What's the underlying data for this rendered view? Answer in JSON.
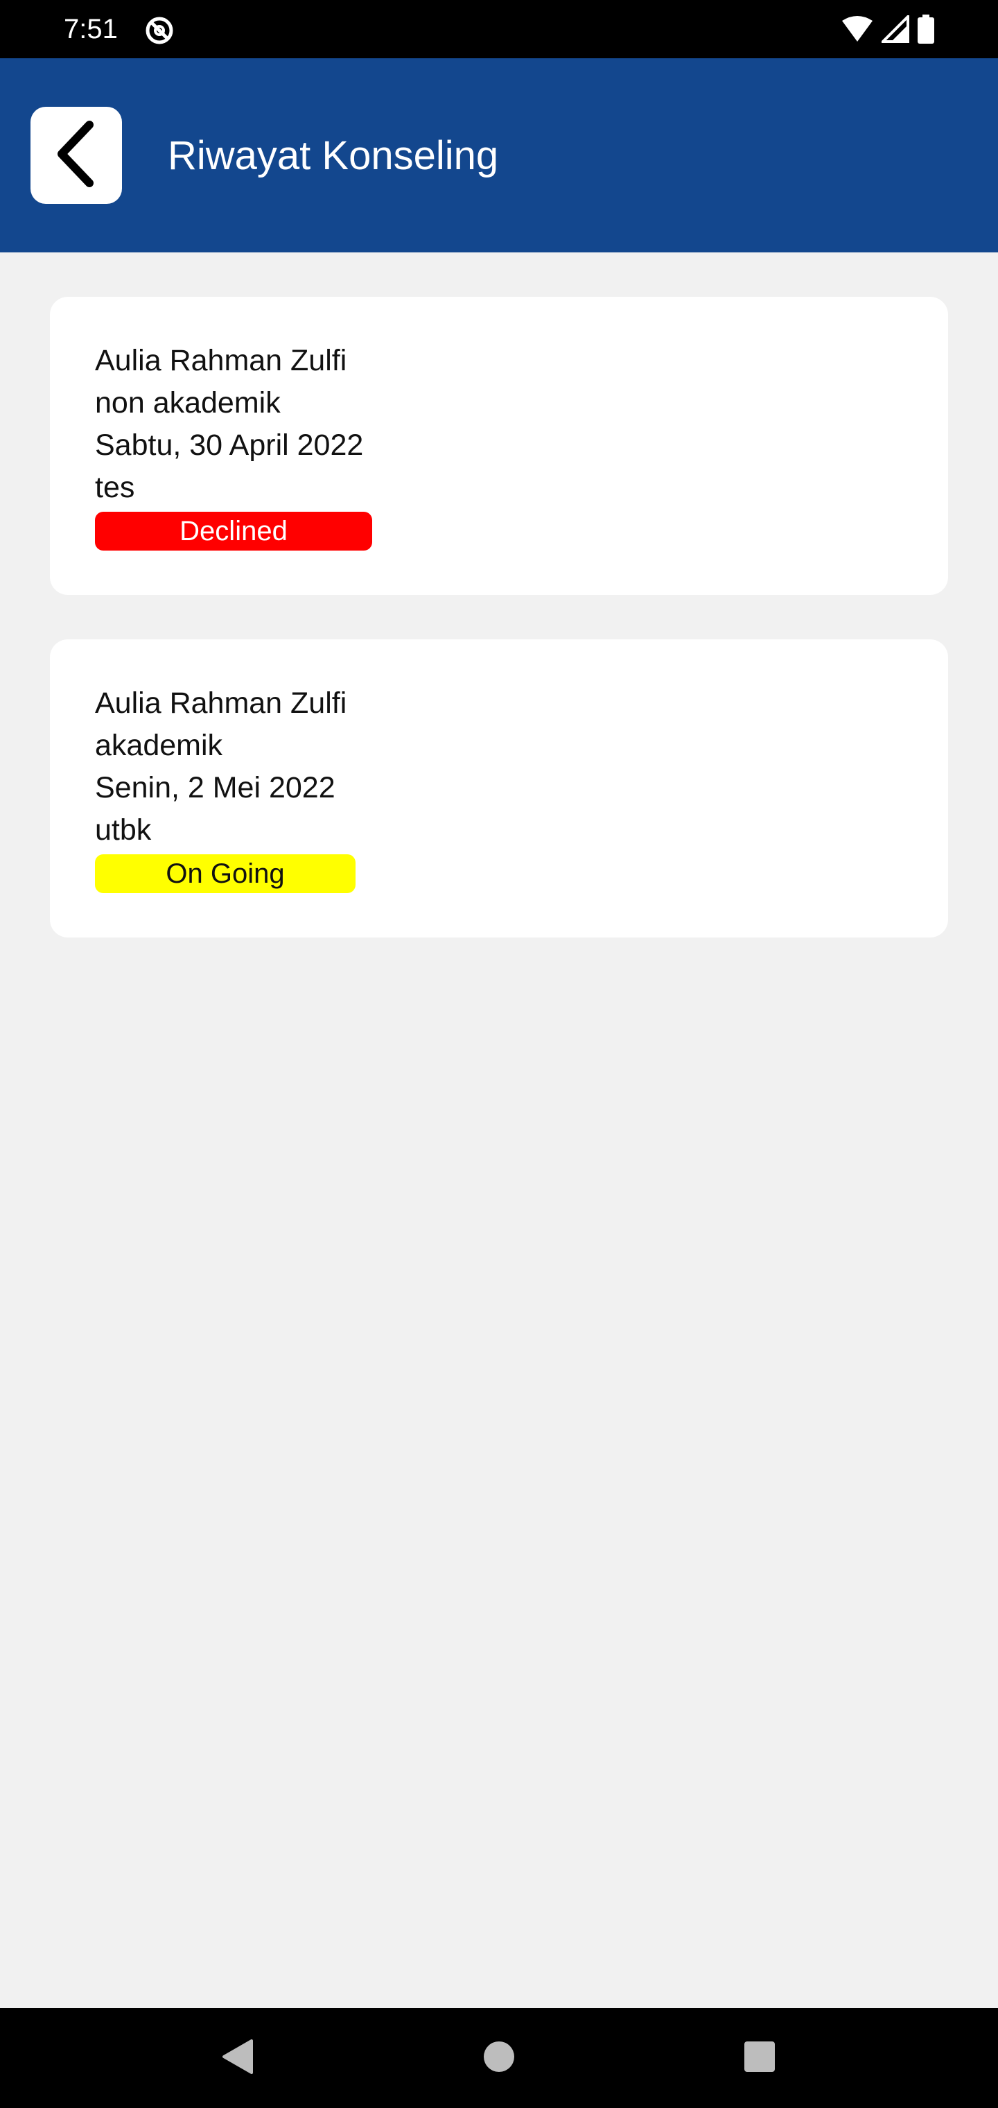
{
  "status_bar": {
    "time": "7:51",
    "icons": [
      "at-sign-icon",
      "wifi-icon",
      "cellular-signal-icon",
      "battery-icon"
    ]
  },
  "header": {
    "title": "Riwayat Konseling",
    "back_icon": "chevron-left-icon",
    "background_color": "#13478e"
  },
  "counseling_history": [
    {
      "name": "Aulia Rahman Zulfi",
      "category": "non akademik",
      "date": "Sabtu, 30 April 2022",
      "topic": "tes",
      "status": "Declined",
      "status_color": "#ff0000",
      "status_text_color": "#ffffff"
    },
    {
      "name": "Aulia Rahman Zulfi",
      "category": "akademik",
      "date": "Senin, 2 Mei 2022",
      "topic": "utbk",
      "status": "On Going",
      "status_color": "#ffff00",
      "status_text_color": "#111111"
    }
  ],
  "navigation_bar": {
    "buttons": [
      "back-triangle-icon",
      "home-circle-icon",
      "recents-square-icon"
    ]
  }
}
